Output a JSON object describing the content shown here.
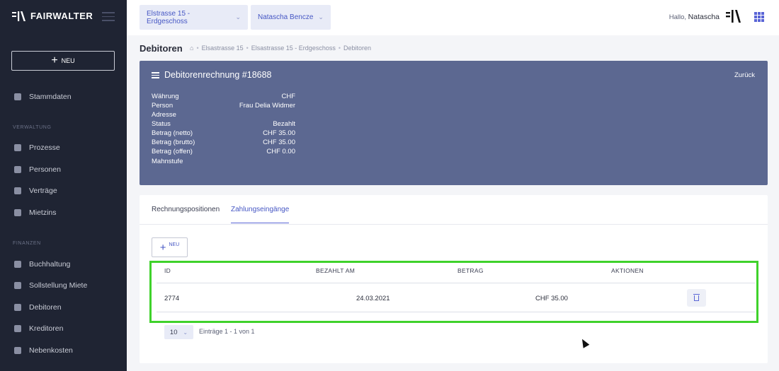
{
  "sidebar": {
    "logo_text": "FAIRWALTER",
    "new_button": "NEU",
    "items_top": [
      {
        "label": "Stammdaten",
        "icon": "database-icon"
      }
    ],
    "section_verwaltung": "VERWALTUNG",
    "items_verwaltung": [
      {
        "label": "Prozesse",
        "icon": "list-icon"
      },
      {
        "label": "Personen",
        "icon": "people-icon"
      },
      {
        "label": "Verträge",
        "icon": "contract-icon"
      },
      {
        "label": "Mietzins",
        "icon": "money-icon"
      }
    ],
    "section_finanzen": "FINANZEN",
    "items_finanzen": [
      {
        "label": "Buchhaltung",
        "icon": "ledger-icon"
      },
      {
        "label": "Sollstellung Miete",
        "icon": "coins-icon"
      },
      {
        "label": "Debitoren",
        "icon": "coins-icon"
      },
      {
        "label": "Kreditoren",
        "icon": "coins-icon"
      },
      {
        "label": "Nebenkosten",
        "icon": "flame-icon"
      }
    ]
  },
  "header": {
    "property_select": "Elstrasse 15 - Erdgeschoss",
    "user_select": "Natascha Bencze",
    "greeting": "Hallo,",
    "user_name": "Natascha"
  },
  "page": {
    "title": "Debitoren",
    "breadcrumb": [
      "Elsastrasse 15",
      "Elsastrasse 15 - Erdgeschoss",
      "Debitoren"
    ]
  },
  "invoice": {
    "title": "Debitorenrechnung #18688",
    "back_label": "Zurück",
    "fields": [
      {
        "label": "Währung",
        "value": "CHF"
      },
      {
        "label": "Person",
        "value": "Frau Delia Widmer"
      },
      {
        "label": "Adresse",
        "value": ""
      },
      {
        "label": "Status",
        "value": "Bezahlt"
      },
      {
        "label": "Betrag (netto)",
        "value": "CHF 35.00"
      },
      {
        "label": "Betrag (brutto)",
        "value": "CHF 35.00"
      },
      {
        "label": "Betrag (offen)",
        "value": "CHF 0.00"
      },
      {
        "label": "Mahnstufe",
        "value": ""
      }
    ]
  },
  "tabs": {
    "positions": "Rechnungspositionen",
    "payments": "Zahlungseingänge"
  },
  "table": {
    "add_label": "NEU",
    "columns": {
      "id": "ID",
      "paid_on": "BEZAHLT AM",
      "amount": "BETRAG",
      "actions": "AKTIONEN"
    },
    "rows": [
      {
        "id": "2774",
        "paid_on": "24.03.2021",
        "amount": "CHF 35.00"
      }
    ],
    "page_size": "10",
    "entries_text": "Einträge 1 - 1 von 1"
  },
  "colors": {
    "sidebar_bg": "#1f2433",
    "accent": "#5a65d6",
    "card_bg": "#5c6891",
    "highlight": "#3fd22b"
  }
}
